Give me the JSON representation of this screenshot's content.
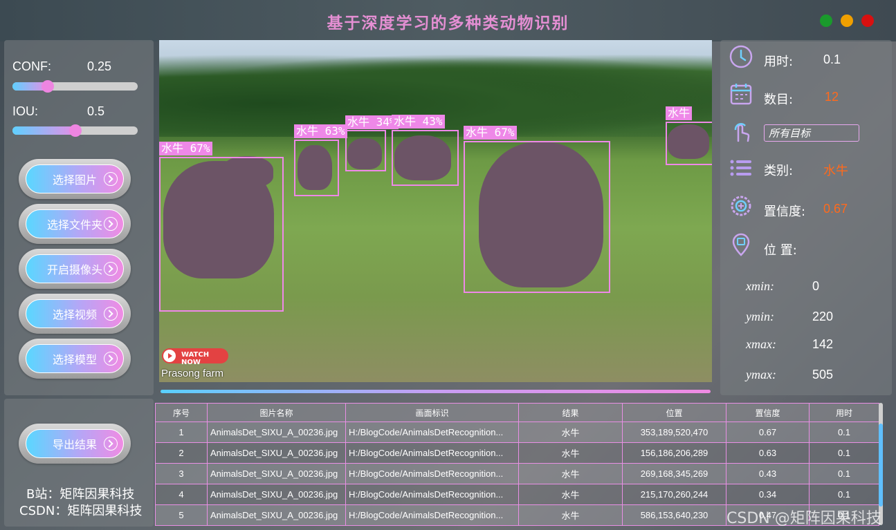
{
  "window": {
    "title": "基于深度学习的多种类动物识别",
    "controls": [
      {
        "name": "green",
        "color": "#1a9a2c"
      },
      {
        "name": "yellow",
        "color": "#f0a000"
      },
      {
        "name": "red",
        "color": "#d81010"
      }
    ]
  },
  "params": {
    "conf_label": "CONF:",
    "conf_value": "0.25",
    "conf_fraction": 0.28,
    "iou_label": "IOU:",
    "iou_value": "0.5",
    "iou_fraction": 0.5
  },
  "buttons": {
    "select_image": "选择图片",
    "select_folder": "选择文件夹",
    "open_camera": "开启摄像头",
    "select_video": "选择视频",
    "select_model": "选择模型",
    "export": "导出结果"
  },
  "video": {
    "detections": [
      {
        "label": "水牛 67%"
      },
      {
        "label": "水牛 63%"
      },
      {
        "label": "水牛 34%"
      },
      {
        "label": "水牛 43%"
      },
      {
        "label": "水牛 67%"
      },
      {
        "label": "水牛"
      }
    ],
    "watermark_badge": "WATCH NOW",
    "caption": "Prasong farm"
  },
  "info": {
    "time_label": "用时:",
    "time_value": "0.1",
    "count_label": "数目:",
    "count_value": "12",
    "target_select": "所有目标",
    "class_label": "类别:",
    "class_value": "水牛",
    "conf_label": "置信度:",
    "conf_value": "0.67",
    "pos_label": "位 置:",
    "xmin_label": "xmin:",
    "xmin": "0",
    "ymin_label": "ymin:",
    "ymin": "220",
    "xmax_label": "xmax:",
    "xmax": "142",
    "ymax_label": "ymax:",
    "ymax": "505"
  },
  "table": {
    "headers": [
      "序号",
      "图片名称",
      "画面标识",
      "结果",
      "位置",
      "置信度",
      "用时"
    ],
    "rows": [
      [
        "1",
        "AnimalsDet_SIXU_A_00236.jpg",
        "H:/BlogCode/AnimalsDetRecognition...",
        "水牛",
        "353,189,520,470",
        "0.67",
        "0.1"
      ],
      [
        "2",
        "AnimalsDet_SIXU_A_00236.jpg",
        "H:/BlogCode/AnimalsDetRecognition...",
        "水牛",
        "156,186,206,289",
        "0.63",
        "0.1"
      ],
      [
        "3",
        "AnimalsDet_SIXU_A_00236.jpg",
        "H:/BlogCode/AnimalsDetRecognition...",
        "水牛",
        "269,168,345,269",
        "0.43",
        "0.1"
      ],
      [
        "4",
        "AnimalsDet_SIXU_A_00236.jpg",
        "H:/BlogCode/AnimalsDetRecognition...",
        "水牛",
        "215,170,260,244",
        "0.34",
        "0.1"
      ],
      [
        "5",
        "AnimalsDet_SIXU_A_00236.jpg",
        "H:/BlogCode/AnimalsDetRecognition...",
        "水牛",
        "586,153,640,230",
        "0.47",
        "0.1"
      ]
    ]
  },
  "credits": {
    "bilibili": "B站：矩阵因果科技",
    "csdn": "CSDN：矩阵因果科技"
  },
  "page_watermark": "CSDN @矩阵因果科技"
}
